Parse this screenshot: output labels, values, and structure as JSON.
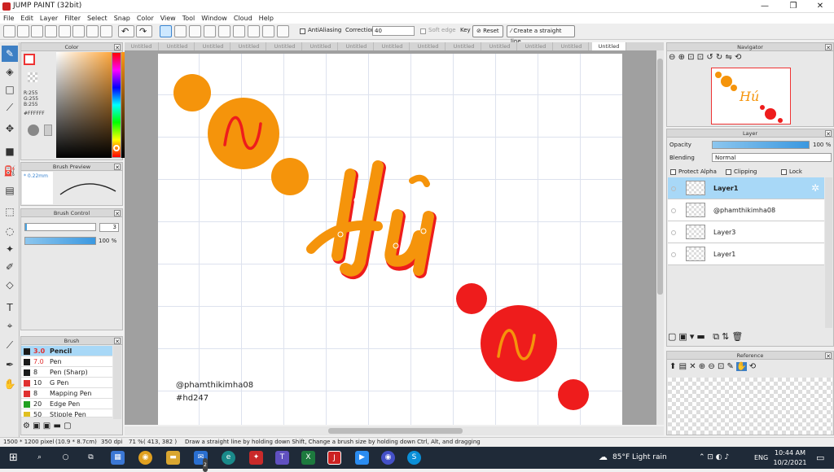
{
  "window": {
    "title": "JUMP PAINT (32bit)",
    "min": "—",
    "max": "❐",
    "close": "✕"
  },
  "menu": [
    "File",
    "Edit",
    "Layer",
    "Filter",
    "Select",
    "Snap",
    "Color",
    "View",
    "Tool",
    "Window",
    "Cloud",
    "Help"
  ],
  "toolbar": {
    "antialiasing_label": "AntiAliasing",
    "correction_label": "Correction",
    "correction_value": "40",
    "soft_edge_label": "Soft edge",
    "key_label": "Key",
    "reset_label": "Reset",
    "straight_line_label": "Create a straight line"
  },
  "tabs": [
    "Untitled",
    "Untitled",
    "Untitled",
    "Untitled",
    "Untitled",
    "Untitled",
    "Untitled",
    "Untitled",
    "Untitled",
    "Untitled",
    "Untitled",
    "Untitled",
    "Untitled",
    "Untitled"
  ],
  "color_panel": {
    "title": "Color",
    "r": "R:255",
    "g": "G:255",
    "b": "B:255",
    "hex": "#FFFFFF"
  },
  "brush_preview": {
    "title": "Brush Preview",
    "size": "0.22mm"
  },
  "brush_control": {
    "title": "Brush Control",
    "size_value": "3",
    "opacity_value": "100 %"
  },
  "brush_list": {
    "title": "Brush",
    "items": [
      {
        "size": "3.0",
        "name": "Pencil",
        "color": "#1a1a1a"
      },
      {
        "size": "7.0",
        "name": "Pen",
        "color": "#1a1a1a"
      },
      {
        "size": "8",
        "name": "Pen (Sharp)",
        "color": "#1a1a1a"
      },
      {
        "size": "10",
        "name": "G Pen",
        "color": "#e03030"
      },
      {
        "size": "8",
        "name": "Mapping Pen",
        "color": "#e03030"
      },
      {
        "size": "20",
        "name": "Edge Pen",
        "color": "#20a020"
      },
      {
        "size": "50",
        "name": "Stipple Pen",
        "color": "#e0c020"
      }
    ]
  },
  "canvas_text": {
    "handle": "@phamthikimha08",
    "hashtag": "#hd247",
    "title_letters": "Hú"
  },
  "navigator": {
    "title": "Navigator"
  },
  "layer_panel": {
    "title": "Layer",
    "opacity_label": "Opacity",
    "opacity_value": "100 %",
    "opacity_fraction": 1.0,
    "blending_label": "Blending",
    "blending_value": "Normal",
    "protect_alpha": "Protect Alpha",
    "clipping": "Clipping",
    "lock": "Lock",
    "layers": [
      "Layer1",
      "@phamthikimha08",
      "Layer3",
      "Layer1"
    ]
  },
  "reference": {
    "title": "Reference"
  },
  "status": {
    "size": "1500 * 1200 pixel",
    "cm": "(10.9 * 8.7cm)",
    "dpi": "350 dpi",
    "zoom": "71 %",
    "coords": "( 413, 382 )",
    "hint": "Draw a straight line by holding down Shift, Change a brush size by holding down Ctrl, Alt, and dragging"
  },
  "taskbar": {
    "weather": "85°F  Light rain",
    "lang": "ENG",
    "time": "10:44 AM",
    "date": "10/2/2021",
    "mail_badge": "2"
  },
  "colors": {
    "orange": "#f5940b",
    "red": "#ee1c1c",
    "accent": "#3d7fc4"
  }
}
